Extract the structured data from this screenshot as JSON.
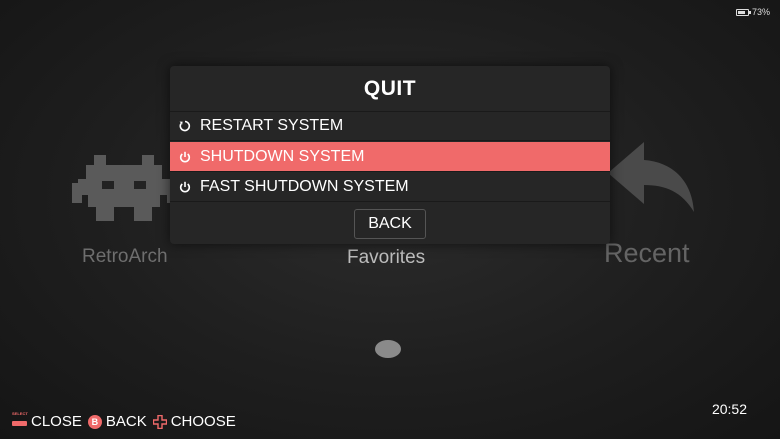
{
  "status": {
    "battery_text": "73%",
    "battery_level": 0.73
  },
  "carousel": {
    "left_label": "RetroArch",
    "center_label": "Favorites",
    "right_label": "Recent"
  },
  "dialog": {
    "title": "QUIT",
    "items": [
      {
        "label": "RESTART SYSTEM",
        "icon": "restart-icon",
        "selected": false
      },
      {
        "label": "SHUTDOWN SYSTEM",
        "icon": "power-icon",
        "selected": true
      },
      {
        "label": "FAST SHUTDOWN SYSTEM",
        "icon": "power-icon",
        "selected": false
      }
    ],
    "back_label": "BACK"
  },
  "footer": {
    "select_text": "SELECT",
    "close_label": "CLOSE",
    "back_label": "BACK",
    "choose_label": "CHOOSE"
  },
  "clock": "20:52",
  "colors": {
    "accent": "#f06a6a",
    "dialog_bg": "#262626"
  }
}
